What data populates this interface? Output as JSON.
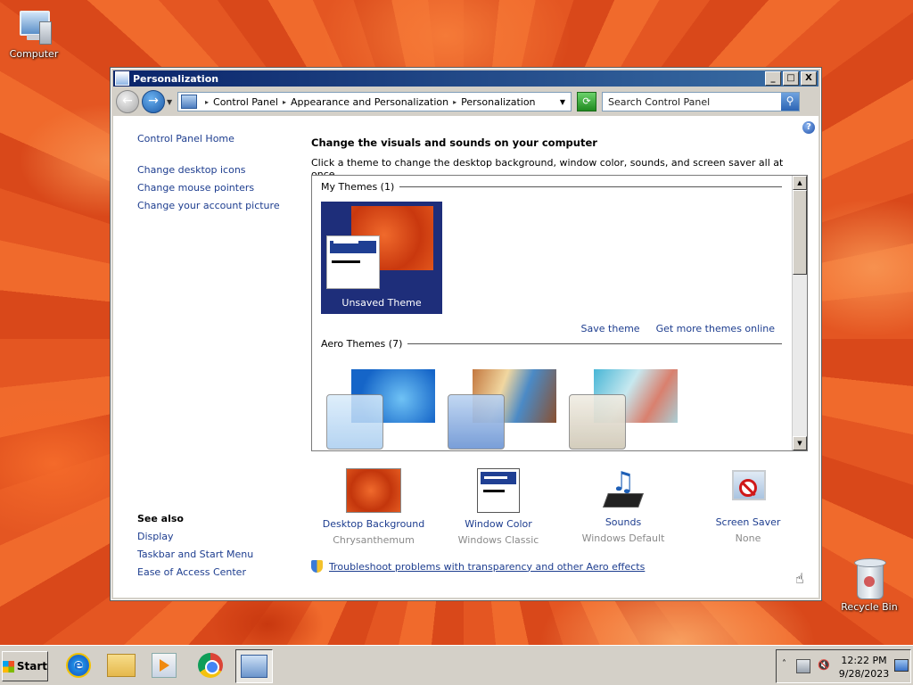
{
  "desktop": {
    "icons": [
      {
        "label": "Computer"
      },
      {
        "label": "Recycle Bin"
      }
    ]
  },
  "window": {
    "title": "Personalization",
    "buttons": {
      "minimize": "_",
      "maximize": "□",
      "close": "X"
    },
    "address": {
      "crumbs": [
        "Control Panel",
        "Appearance and Personalization",
        "Personalization"
      ]
    },
    "search": {
      "placeholder": "Search Control Panel"
    }
  },
  "leftnav": {
    "home": "Control Panel Home",
    "links": [
      "Change desktop icons",
      "Change mouse pointers",
      "Change your account picture"
    ],
    "see_also": {
      "heading": "See also",
      "links": [
        "Display",
        "Taskbar and Start Menu",
        "Ease of Access Center"
      ]
    }
  },
  "main": {
    "heading": "Change the visuals and sounds on your computer",
    "description": "Click a theme to change the desktop background, window color, sounds, and screen saver all at once.",
    "my_themes": {
      "label": "My Themes (1)",
      "themes": [
        {
          "name": "Unsaved Theme"
        }
      ],
      "save_link": "Save theme",
      "online_link": "Get more themes online"
    },
    "aero_themes": {
      "label": "Aero Themes (7)"
    },
    "settings": [
      {
        "name": "Desktop Background",
        "value": "Chrysanthemum"
      },
      {
        "name": "Window Color",
        "value": "Windows Classic"
      },
      {
        "name": "Sounds",
        "value": "Windows Default"
      },
      {
        "name": "Screen Saver",
        "value": "None"
      }
    ],
    "troubleshoot": "Troubleshoot problems with transparency and other Aero effects"
  },
  "taskbar": {
    "start": "Start",
    "apps": [
      "internet-explorer",
      "windows-explorer",
      "media-player",
      "chrome",
      "control-panel"
    ],
    "clock": {
      "time": "12:22 PM",
      "date": "9/28/2023"
    }
  }
}
